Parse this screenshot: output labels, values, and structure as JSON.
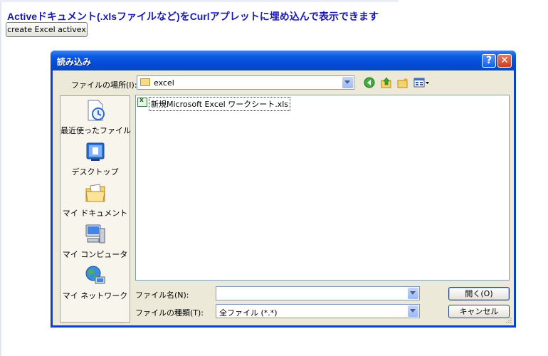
{
  "page": {
    "heading": "Activeドキュメント(.xlsファイルなど)をCurlアプレットに埋め込んで表示できます",
    "create_button": "create Excel activex"
  },
  "dialog": {
    "title": "読み込み",
    "help_label": "?",
    "close_label": "✕",
    "lookin_label": "ファイルの場所(I):",
    "lookin_value": "excel",
    "toolbar_icons": [
      "back-icon",
      "up-folder-icon",
      "new-folder-icon",
      "view-menu-icon"
    ],
    "places": [
      {
        "label": "最近使ったファイル",
        "icon": "recent-documents-icon"
      },
      {
        "label": "デスクトップ",
        "icon": "desktop-icon"
      },
      {
        "label": "マイ ドキュメント",
        "icon": "my-documents-icon"
      },
      {
        "label": "マイ コンピュータ",
        "icon": "my-computer-icon"
      },
      {
        "label": "マイ ネットワーク",
        "icon": "my-network-icon"
      }
    ],
    "files": [
      {
        "name": "新規Microsoft Excel ワークシート.xls",
        "icon": "excel-file-icon"
      }
    ],
    "filename_label": "ファイル名(N):",
    "filename_value": "",
    "filetype_label": "ファイルの種類(T):",
    "filetype_value": "全ファイル (*.*)",
    "open_button": "開く(O)",
    "cancel_button": "キャンセル"
  }
}
